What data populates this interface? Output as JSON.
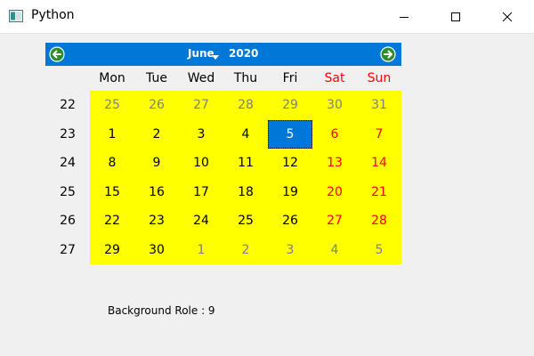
{
  "window": {
    "title": "Python"
  },
  "calendar": {
    "month": "June",
    "year": "2020",
    "day_headers": [
      "Mon",
      "Tue",
      "Wed",
      "Thu",
      "Fri",
      "Sat",
      "Sun"
    ],
    "weeks": [
      {
        "num": "22",
        "days": [
          {
            "d": "25",
            "other": true
          },
          {
            "d": "26",
            "other": true
          },
          {
            "d": "27",
            "other": true
          },
          {
            "d": "28",
            "other": true
          },
          {
            "d": "29",
            "other": true
          },
          {
            "d": "30",
            "other": true
          },
          {
            "d": "31",
            "other": true
          }
        ]
      },
      {
        "num": "23",
        "days": [
          {
            "d": "1"
          },
          {
            "d": "2"
          },
          {
            "d": "3"
          },
          {
            "d": "4"
          },
          {
            "d": "5",
            "selected": true
          },
          {
            "d": "6"
          },
          {
            "d": "7"
          }
        ]
      },
      {
        "num": "24",
        "days": [
          {
            "d": "8"
          },
          {
            "d": "9"
          },
          {
            "d": "10"
          },
          {
            "d": "11"
          },
          {
            "d": "12"
          },
          {
            "d": "13"
          },
          {
            "d": "14"
          }
        ]
      },
      {
        "num": "25",
        "days": [
          {
            "d": "15"
          },
          {
            "d": "16"
          },
          {
            "d": "17"
          },
          {
            "d": "18"
          },
          {
            "d": "19"
          },
          {
            "d": "20"
          },
          {
            "d": "21"
          }
        ]
      },
      {
        "num": "26",
        "days": [
          {
            "d": "22"
          },
          {
            "d": "23"
          },
          {
            "d": "24"
          },
          {
            "d": "25"
          },
          {
            "d": "26"
          },
          {
            "d": "27"
          },
          {
            "d": "28"
          }
        ]
      },
      {
        "num": "27",
        "days": [
          {
            "d": "29"
          },
          {
            "d": "30"
          },
          {
            "d": "1",
            "other": true
          },
          {
            "d": "2",
            "other": true
          },
          {
            "d": "3",
            "other": true
          },
          {
            "d": "4",
            "other": true
          },
          {
            "d": "5",
            "other": true
          }
        ]
      }
    ]
  },
  "label": {
    "background_role": "Background Role : 9"
  },
  "colors": {
    "accent": "#0078d7",
    "cell_background": "#ffff00",
    "weekend": "#ff0000",
    "other_month": "#808080"
  },
  "icons": {
    "app": "python-window-icon",
    "prev": "arrow-left-icon",
    "next": "arrow-right-icon"
  }
}
